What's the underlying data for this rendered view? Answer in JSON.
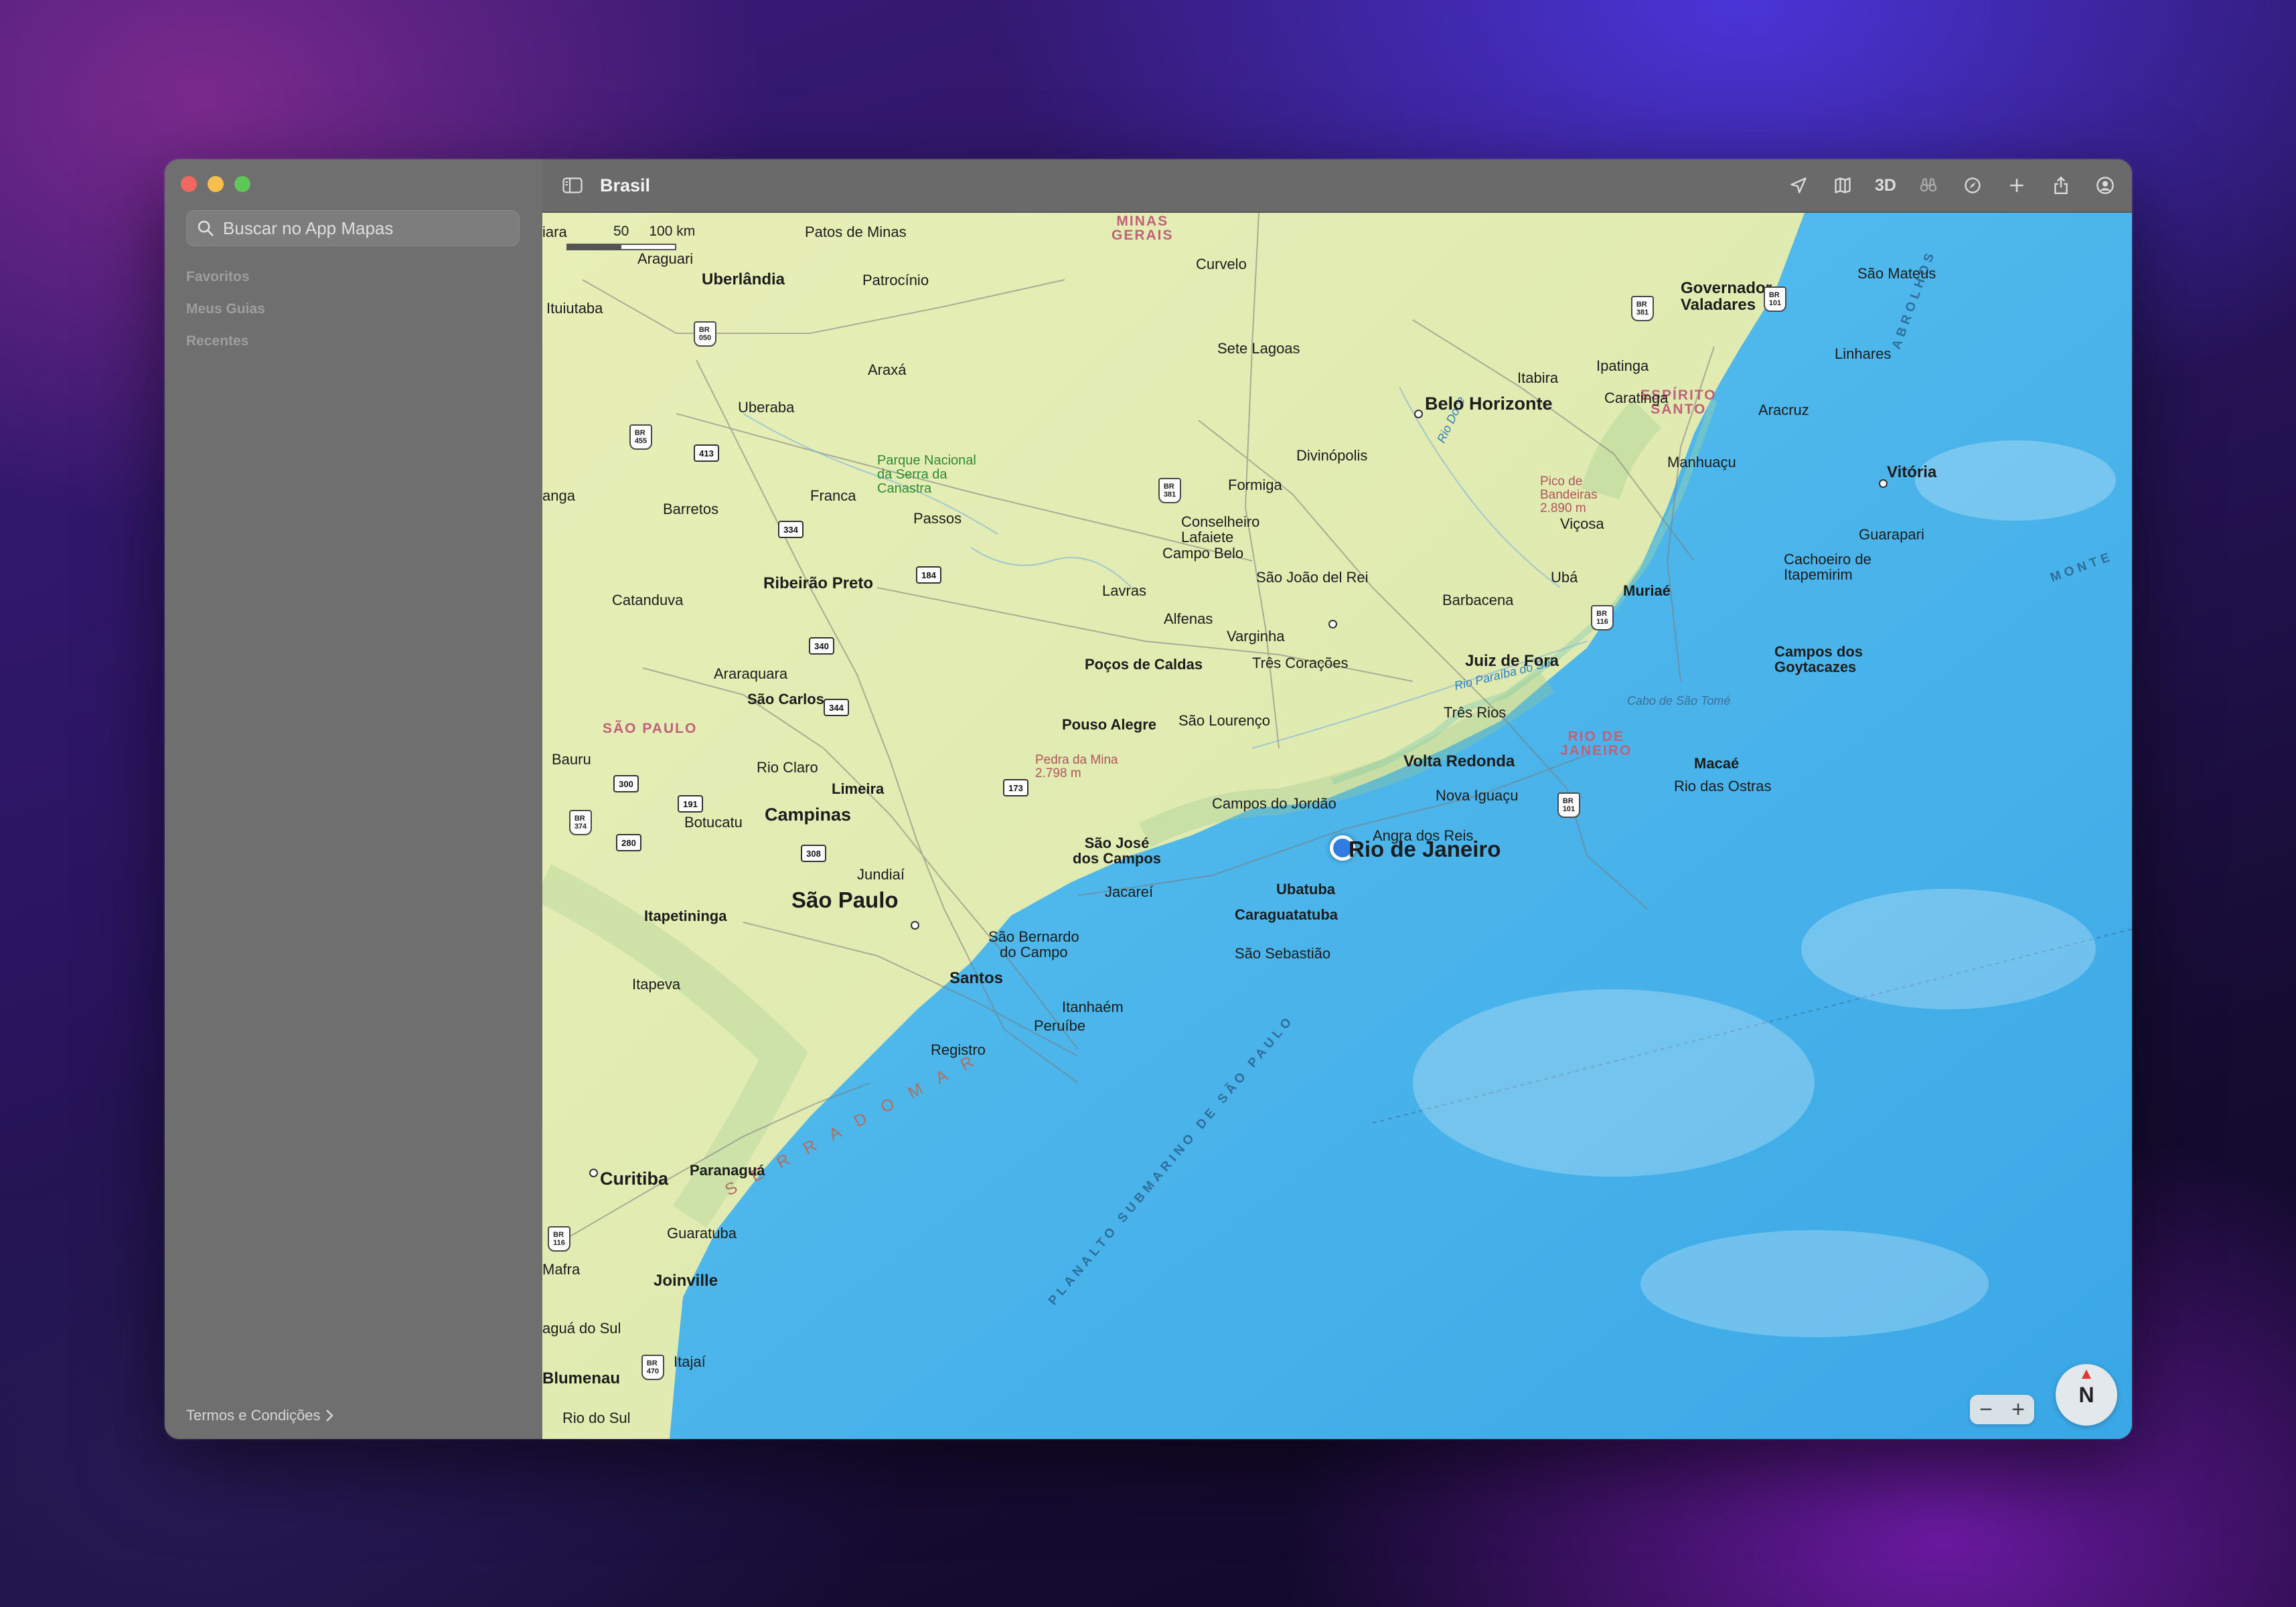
{
  "window": {
    "title": "Brasil"
  },
  "sidebar": {
    "search_placeholder": "Buscar no App Mapas",
    "sections": [
      "Favoritos",
      "Meus Guias",
      "Recentes"
    ],
    "terms_label": "Termos e Condições"
  },
  "toolbar": {
    "tools": [
      "location-arrow-icon",
      "map-mode-icon",
      "3D",
      "binoculars-icon",
      "look-around-icon",
      "add-icon",
      "share-icon",
      "account-icon"
    ],
    "label_3d": "3D"
  },
  "map": {
    "scale_labels": [
      "50",
      "100 km"
    ],
    "zoom_out": "−",
    "zoom_in": "+",
    "compass": "N",
    "current_location": "Rio de Janeiro",
    "cities": {
      "rio": "Rio de Janeiro",
      "sao_paulo": "São Paulo",
      "belo_horizonte": "Belo Horizonte",
      "campinas": "Campinas",
      "curitiba": "Curitiba",
      "vitoria": "Vitória",
      "uberlandia": "Uberlândia",
      "ribeirao": "Ribeirão Preto",
      "juiz_de_fora": "Juiz de Fora",
      "volta_redonda": "Volta Redonda",
      "santos": "Santos",
      "joinville": "Joinville",
      "blumenau": "Blumenau",
      "gov_valadares": "Governador\nValadares",
      "campos": "Campos dos\nGoytacazes",
      "patos": "Patos de Minas",
      "araguari": "Araguari",
      "patrocinio": "Patrocínio",
      "curvelo": "Curvelo",
      "sao_mateus": "São Mateus",
      "ituiutaba": "Ituiutaba",
      "sete_lagoas": "Sete Lagoas",
      "itabira": "Itabira",
      "ipatinga": "Ipatinga",
      "linhares": "Linhares",
      "araxa": "Araxá",
      "uberaba": "Uberaba",
      "caratinga": "Caratinga",
      "aracruz": "Aracruz",
      "divinopolis": "Divinópolis",
      "manhuacu": "Manhuaçu",
      "formiga": "Formiga",
      "franca": "Franca",
      "barretos": "Barretos",
      "passos": "Passos",
      "cons_lafaiete": "Conselheiro\nLafaiete",
      "vicosa": "Viçosa",
      "guarapari": "Guarapari",
      "campo_belo": "Campo Belo",
      "cachoeiro": "Cachoeiro de\nItapemirim",
      "sjdr": "São João del Rei",
      "uba": "Ubá",
      "catanduva": "Catanduva",
      "lavras": "Lavras",
      "barbacena": "Barbacena",
      "muriae": "Muriaé",
      "alfenas": "Alfenas",
      "varginha": "Varginha",
      "araraquara": "Araraquara",
      "pocos": "Poços de Caldas",
      "tres_coracoes": "Três Corações",
      "sao_carlos": "São Carlos",
      "tres_rios": "Três Rios",
      "pouso_alegre": "Pouso Alegre",
      "sao_lourenco": "São Lourenço",
      "bauru": "Bauru",
      "rio_claro": "Rio Claro",
      "limeira": "Limeira",
      "macae": "Macaé",
      "rio_ostras": "Rio das Ostras",
      "campos_jordao": "Campos do Jordão",
      "nova_iguacu": "Nova Iguaçu",
      "botucatu": "Botucatu",
      "angra": "Angra dos Reis",
      "sjc": "São José\ndos Campos",
      "jundiai": "Jundiaí",
      "jacarei": "Jacareí",
      "ubatuba": "Ubatuba",
      "itapetininga": "Itapetininga",
      "caraguatatuba": "Caraguatatuba",
      "sbc": "São Bernardo\ndo Campo",
      "sao_sebastiao": "São Sebastião",
      "itapeva": "Itapeva",
      "itanhaem": "Itanhaém",
      "peruibe": "Peruíbe",
      "registro": "Registro",
      "paranagua": "Paranaguá",
      "guaratuba": "Guaratuba",
      "itajai": "Itajaí",
      "rio_do_sul": "Rio do Sul",
      "lagua_do_sul": "aguá do Sul",
      "mafra": "Mafra",
      "iara": "iara",
      "anga": "anga"
    },
    "states": {
      "mg": "MINAS\nGERAIS",
      "sp": "SÃO PAULO",
      "es": "ESPÍRITO\nSANTO",
      "rj": "RIO DE\nJANEIRO"
    },
    "features": {
      "park": "Parque Nacional\nda Serra da\nCanastra",
      "pico_bandeira": "Pico de\nBandeiras\n2.890 m",
      "pedra_mina": "Pedra da Mina\n2.798 m",
      "rio_doce": "Rio Doce",
      "rio_paraiba": "Rio Paraíba do Sul",
      "cabo": "Cabo de São Tomé",
      "abrolhos": "ABROLHOS",
      "planalto": "PLANALTO SUBMARINO DE SÃO PAULO",
      "monte": "MONTE",
      "serra_mar": "S E R R A   D O   M A R"
    },
    "highways": [
      "BR 050",
      "BR 455",
      "413",
      "334",
      "BR 381",
      "184",
      "340",
      "344",
      "BR 116",
      "BR 381",
      "BR 101",
      "300",
      "191",
      "173",
      "BR 101",
      "BR 374",
      "280",
      "308",
      "BR 116",
      "BR 470"
    ]
  }
}
